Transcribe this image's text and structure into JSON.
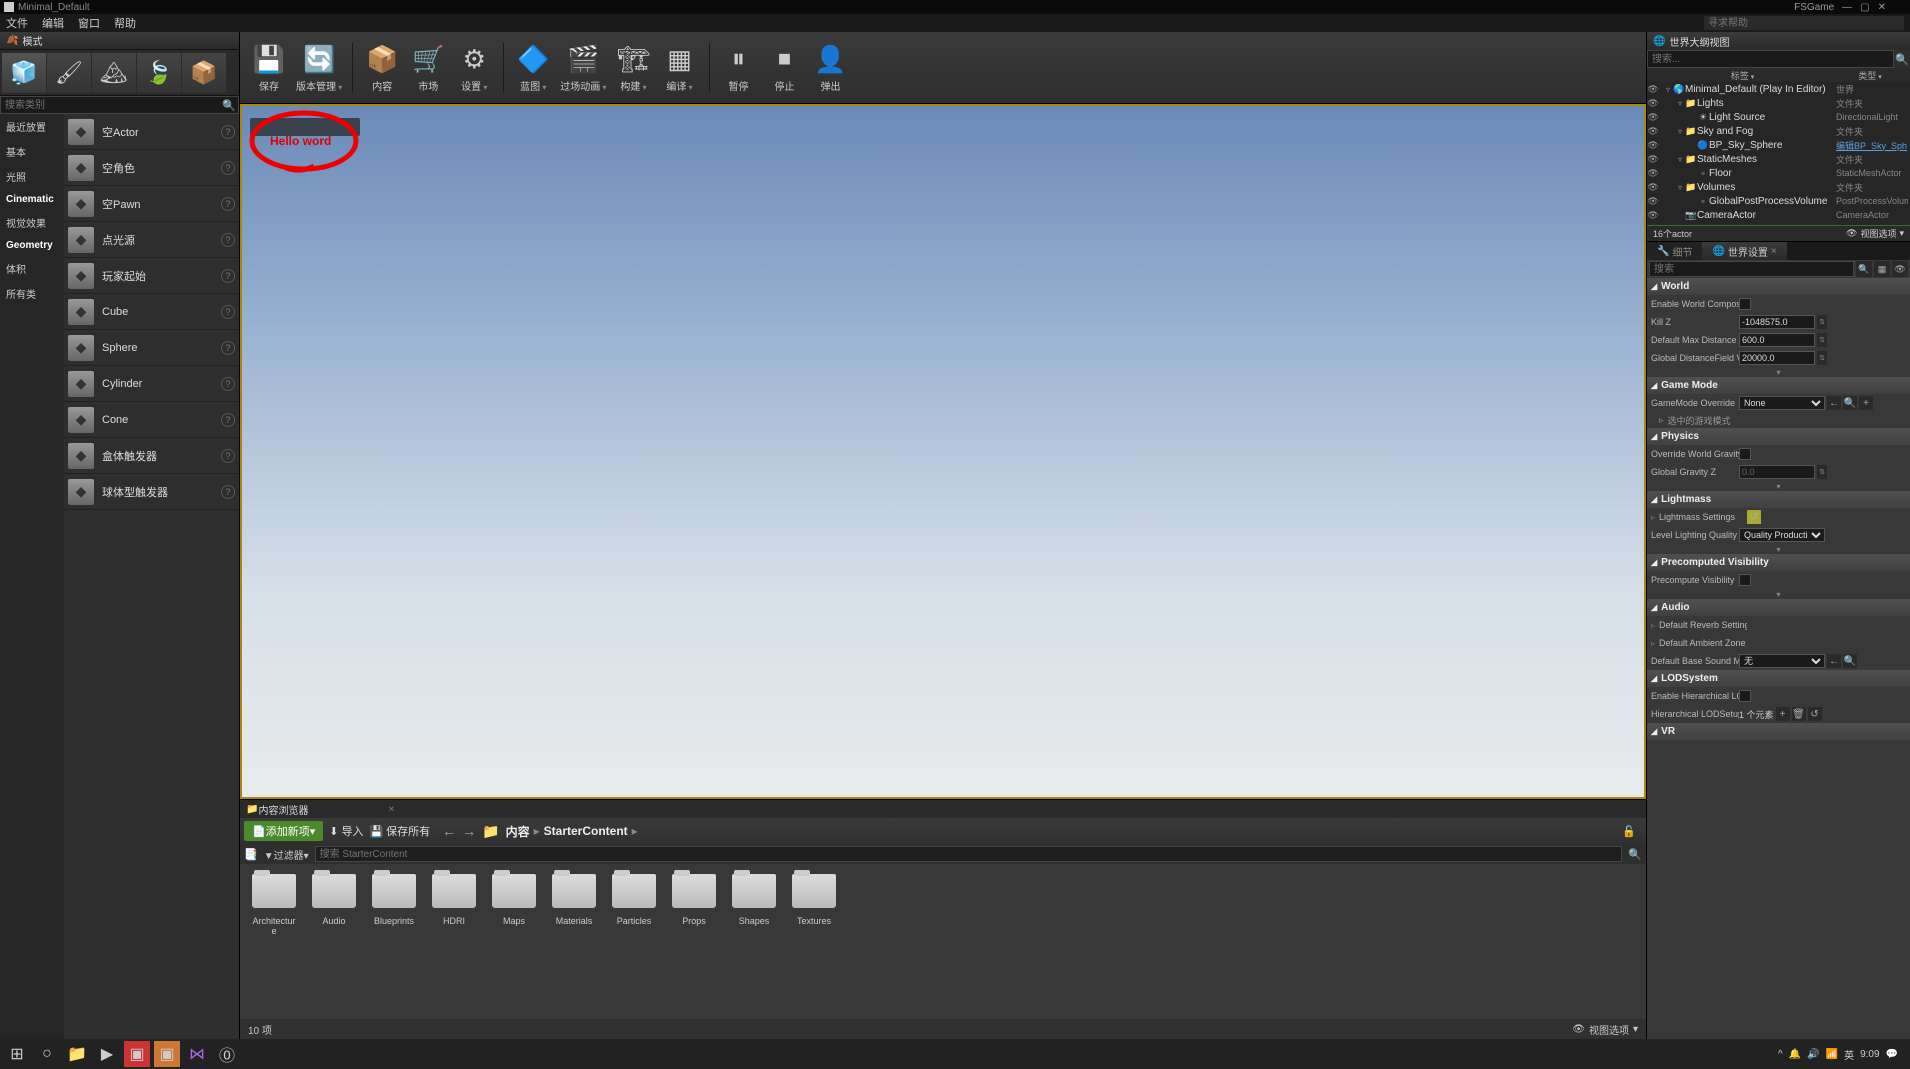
{
  "titlebar": {
    "title": "Minimal_Default",
    "right_app": "FSGame"
  },
  "menu": {
    "file": "文件",
    "edit": "编辑",
    "window": "窗口",
    "help": "帮助",
    "help_search": "寻求帮助"
  },
  "modes": {
    "tab": "模式",
    "search_ph": "搜索类别",
    "categories": [
      "最近放置",
      "基本",
      "光照",
      "Cinematic",
      "视觉效果",
      "Geometry",
      "体积",
      "所有类"
    ],
    "bold_cats": [
      "Cinematic",
      "Geometry"
    ],
    "items": [
      {
        "label": "空Actor"
      },
      {
        "label": "空角色"
      },
      {
        "label": "空Pawn"
      },
      {
        "label": "点光源"
      },
      {
        "label": "玩家起始"
      },
      {
        "label": "Cube"
      },
      {
        "label": "Sphere"
      },
      {
        "label": "Cylinder"
      },
      {
        "label": "Cone"
      },
      {
        "label": "盒体触发器"
      },
      {
        "label": "球体型触发器"
      }
    ]
  },
  "toolbar": [
    {
      "label": "保存",
      "icon": "💾"
    },
    {
      "label": "版本管理",
      "icon": "🔄",
      "drop": true
    },
    {
      "label": "内容",
      "icon": "📦"
    },
    {
      "label": "市场",
      "icon": "🛒"
    },
    {
      "label": "设置",
      "icon": "⚙",
      "drop": true
    },
    {
      "label": "蓝图",
      "icon": "🔷",
      "drop": true
    },
    {
      "label": "过场动画",
      "icon": "🎬",
      "drop": true
    },
    {
      "label": "构建",
      "icon": "🏗",
      "drop": true
    },
    {
      "label": "编译",
      "icon": "▦",
      "drop": true
    },
    {
      "label": "暂停",
      "icon": "⏸"
    },
    {
      "label": "停止",
      "icon": "⏹"
    },
    {
      "label": "弹出",
      "icon": "👤"
    }
  ],
  "viewport": {
    "hello": "Hello word"
  },
  "content_browser": {
    "tab": "内容浏览器",
    "add_new": "添加新项",
    "import": "导入",
    "save_all": "保存所有",
    "path_root": "内容",
    "path_folder": "StarterContent",
    "filters": "过滤器",
    "search_ph": "搜索 StarterContent",
    "folders": [
      "Architecture",
      "Audio",
      "Blueprints",
      "HDRI",
      "Maps",
      "Materials",
      "Particles",
      "Props",
      "Shapes",
      "Textures"
    ],
    "count": "10 项",
    "view_options": "视图选项"
  },
  "outliner": {
    "title": "世界大纲视图",
    "search_ph": "搜索...",
    "col_label": "标签",
    "col_type": "类型",
    "rows": [
      {
        "name": "Minimal_Default (Play In Editor)",
        "type": "世界",
        "depth": 0,
        "arrow": "▿",
        "ic": "🌎"
      },
      {
        "name": "Lights",
        "type": "文件夹",
        "depth": 1,
        "arrow": "▿",
        "ic": "📁"
      },
      {
        "name": "Light Source",
        "type": "DirectionalLight",
        "depth": 2,
        "arrow": "",
        "ic": "☀"
      },
      {
        "name": "Sky and Fog",
        "type": "文件夹",
        "depth": 1,
        "arrow": "▿",
        "ic": "📁"
      },
      {
        "name": "BP_Sky_Sphere",
        "type": "编辑BP_Sky_Sph",
        "depth": 2,
        "arrow": "",
        "ic": "🔵",
        "link": true
      },
      {
        "name": "StaticMeshes",
        "type": "文件夹",
        "depth": 1,
        "arrow": "▿",
        "ic": "📁"
      },
      {
        "name": "Floor",
        "type": "StaticMeshActor",
        "depth": 2,
        "arrow": "",
        "ic": "▫"
      },
      {
        "name": "Volumes",
        "type": "文件夹",
        "depth": 1,
        "arrow": "▿",
        "ic": "📁"
      },
      {
        "name": "GlobalPostProcessVolume",
        "type": "PostProcessVolum",
        "depth": 2,
        "arrow": "",
        "ic": "▫"
      },
      {
        "name": "CameraActor",
        "type": "CameraActor",
        "depth": 1,
        "arrow": "",
        "ic": "📷"
      }
    ],
    "status": "16个actor",
    "view_options": "视图选项"
  },
  "tabs": {
    "details": "细节",
    "world_settings": "世界设置"
  },
  "details": {
    "search_ph": "搜索",
    "sections": [
      {
        "title": "World",
        "rows": [
          {
            "label": "Enable World Compos",
            "type": "check"
          },
          {
            "label": "Kill Z",
            "type": "num",
            "value": "-1048575.0"
          },
          {
            "label": "Default Max Distance",
            "type": "num",
            "value": "600.0"
          },
          {
            "label": "Global DistanceField V",
            "type": "num",
            "value": "20000.0"
          }
        ],
        "expand": true
      },
      {
        "title": "Game Mode",
        "rows": [
          {
            "label": "GameMode Override",
            "type": "select",
            "value": "None",
            "extras": true
          }
        ],
        "sub": "选中的游戏模式"
      },
      {
        "title": "Physics",
        "rows": [
          {
            "label": "Override World Gravity",
            "type": "check"
          },
          {
            "label": "Global Gravity Z",
            "type": "num",
            "value": "0.0",
            "dim": true
          }
        ],
        "expand": true
      },
      {
        "title": "Lightmass",
        "rows": [
          {
            "label": "Lightmass Settings",
            "type": "reset"
          },
          {
            "label": "Level Lighting Quality",
            "type": "select",
            "value": "Quality Production"
          }
        ],
        "expand": true
      },
      {
        "title": "Precomputed Visibility",
        "rows": [
          {
            "label": "Precompute Visibility",
            "type": "check"
          }
        ],
        "expand": true
      },
      {
        "title": "Audio",
        "rows": [
          {
            "label": "Default Reverb Settings",
            "type": "expand"
          },
          {
            "label": "Default Ambient Zone",
            "type": "expand"
          },
          {
            "label": "Default Base Sound M",
            "type": "select",
            "value": "无",
            "extras2": true
          }
        ]
      },
      {
        "title": "LODSystem",
        "rows": [
          {
            "label": "Enable Hierarchical LO",
            "type": "check"
          },
          {
            "label": "Hierarchical LODSetup",
            "type": "text",
            "value": "1 个元素",
            "extras3": true
          }
        ]
      },
      {
        "title": "VR",
        "rows": []
      }
    ]
  },
  "taskbar": {
    "time": "9:09",
    "ime": "英"
  }
}
